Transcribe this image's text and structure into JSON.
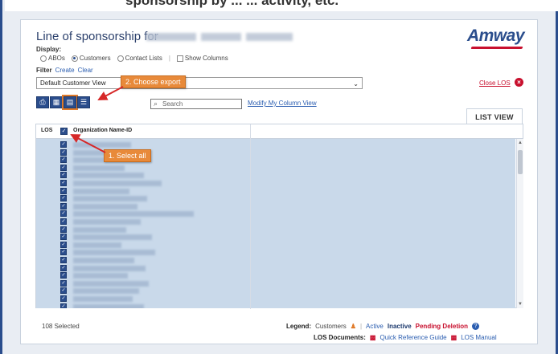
{
  "top_strip_text": "sponsorship by  ...    ...  activity, etc.",
  "header": {
    "title": "Line of sponsorship for",
    "logo": "Amway"
  },
  "display": {
    "label": "Display:",
    "options": [
      {
        "label": "ABOs",
        "selected": false
      },
      {
        "label": "Customers",
        "selected": true
      },
      {
        "label": "Contact Lists",
        "selected": false
      }
    ],
    "show_columns_label": "Show Columns"
  },
  "filter": {
    "label": "Filter",
    "create": "Create",
    "clear": "Clear",
    "selected": "Default Customer View"
  },
  "close_los": "Close LOS",
  "toolbar": {
    "icons": [
      "print-icon",
      "grid-icon",
      "export-icon",
      "list-icon"
    ]
  },
  "search": {
    "placeholder": "Search"
  },
  "modify_link": "Modify My Column View",
  "list_view_tab": "LIST VIEW",
  "grid": {
    "col_los": "LOS",
    "col_org": "Organization Name-ID",
    "row_count": 22
  },
  "footer": {
    "selected": "108 Selected",
    "legend_label": "Legend:",
    "customers": "Customers",
    "active": "Active",
    "inactive": "Inactive",
    "pending": "Pending Deletion",
    "docs_label": "LOS Documents:",
    "quick_ref": "Quick Reference Guide",
    "manual": "LOS Manual"
  },
  "annotations": {
    "export": "2. Choose export",
    "select_all": "1. Select all"
  },
  "colors": {
    "brand": "#2a4d8c",
    "accent": "#c8102e",
    "callout": "#e88a3a",
    "selection": "#c9d9ea"
  }
}
